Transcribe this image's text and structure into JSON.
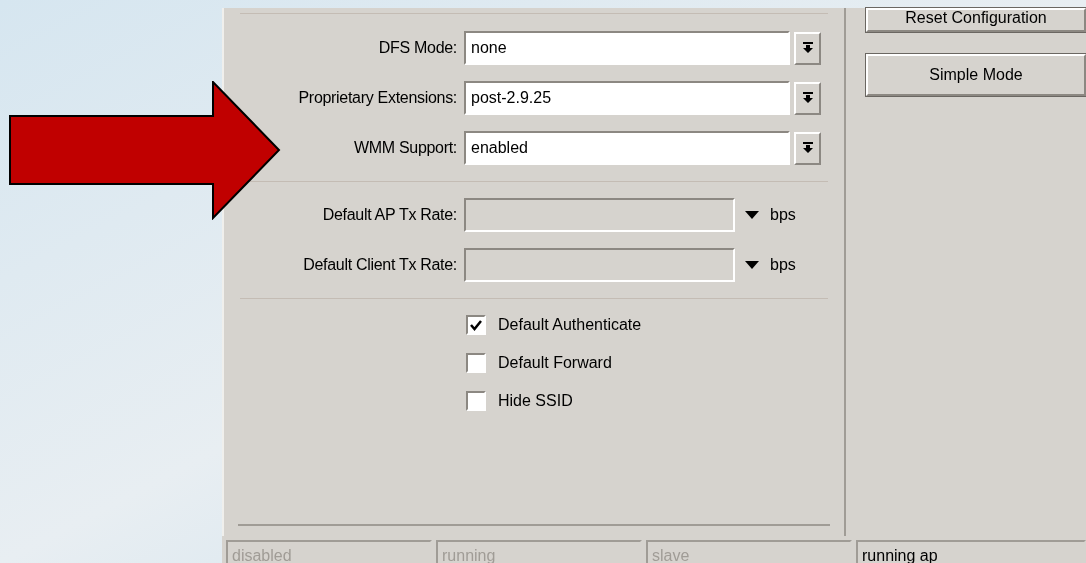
{
  "fields": [
    {
      "kind": "combo",
      "label": "DFS Mode:",
      "value": "none",
      "disabled": false
    },
    {
      "kind": "combo",
      "label": "Proprietary Extensions:",
      "value": "post-2.9.25",
      "disabled": false
    },
    {
      "kind": "combo",
      "label": "WMM Support:",
      "value": "enabled",
      "disabled": false
    },
    {
      "kind": "separator"
    },
    {
      "kind": "rate",
      "label": "Default AP Tx Rate:",
      "unit": "bps",
      "disabled": true
    },
    {
      "kind": "rate",
      "label": "Default Client Tx Rate:",
      "unit": "bps",
      "disabled": true
    },
    {
      "kind": "separator"
    }
  ],
  "checkboxes": [
    {
      "label": "Default Authenticate",
      "checked": true
    },
    {
      "label": "Default Forward",
      "checked": false
    },
    {
      "label": "Hide SSID",
      "checked": false
    }
  ],
  "buttons": [
    "Reset Configuration",
    "Simple Mode"
  ],
  "status_bar": [
    {
      "text": "disabled",
      "disabled": true
    },
    {
      "text": "running",
      "disabled": true
    },
    {
      "text": "slave",
      "disabled": true
    },
    {
      "text": "running ap",
      "disabled": false
    }
  ]
}
